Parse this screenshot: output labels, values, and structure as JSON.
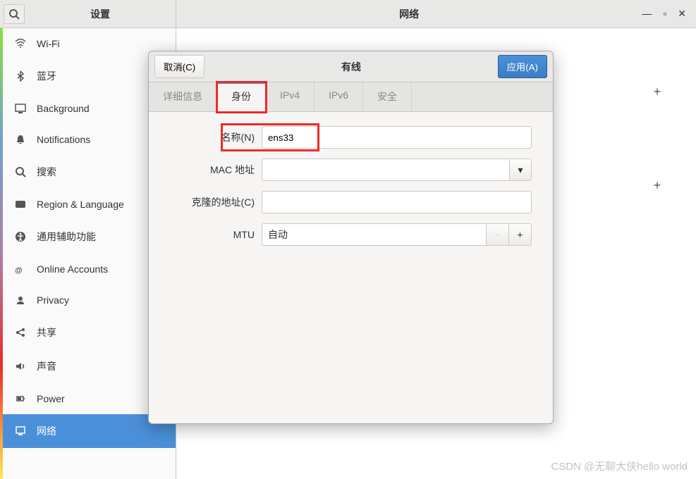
{
  "titlebar": {
    "left_title": "设置",
    "right_title": "网络"
  },
  "sidebar": {
    "items": [
      {
        "label": "Wi-Fi",
        "icon": "wifi"
      },
      {
        "label": "蓝牙",
        "icon": "bluetooth"
      },
      {
        "label": "Background",
        "icon": "background"
      },
      {
        "label": "Notifications",
        "icon": "bell"
      },
      {
        "label": "搜索",
        "icon": "search"
      },
      {
        "label": "Region & Language",
        "icon": "region"
      },
      {
        "label": "通用辅助功能",
        "icon": "accessibility"
      },
      {
        "label": "Online Accounts",
        "icon": "accounts"
      },
      {
        "label": "Privacy",
        "icon": "privacy"
      },
      {
        "label": "共享",
        "icon": "share"
      },
      {
        "label": "声音",
        "icon": "sound"
      },
      {
        "label": "Power",
        "icon": "power"
      },
      {
        "label": "网络",
        "icon": "network",
        "selected": true
      }
    ]
  },
  "dialog": {
    "cancel": "取消(C)",
    "apply": "应用(A)",
    "title": "有线",
    "tabs": [
      {
        "label": "详细信息"
      },
      {
        "label": "身份",
        "active": true,
        "highlighted": true
      },
      {
        "label": "IPv4"
      },
      {
        "label": "IPv6"
      },
      {
        "label": "安全"
      }
    ],
    "form": {
      "name_label": "名称(N)",
      "name_value": "ens33",
      "mac_label": "MAC 地址",
      "mac_value": "",
      "clone_label": "克隆的地址(C)",
      "clone_value": "",
      "mtu_label": "MTU",
      "mtu_value": "自动"
    }
  },
  "watermark": "CSDN @无聊大侠hello world"
}
